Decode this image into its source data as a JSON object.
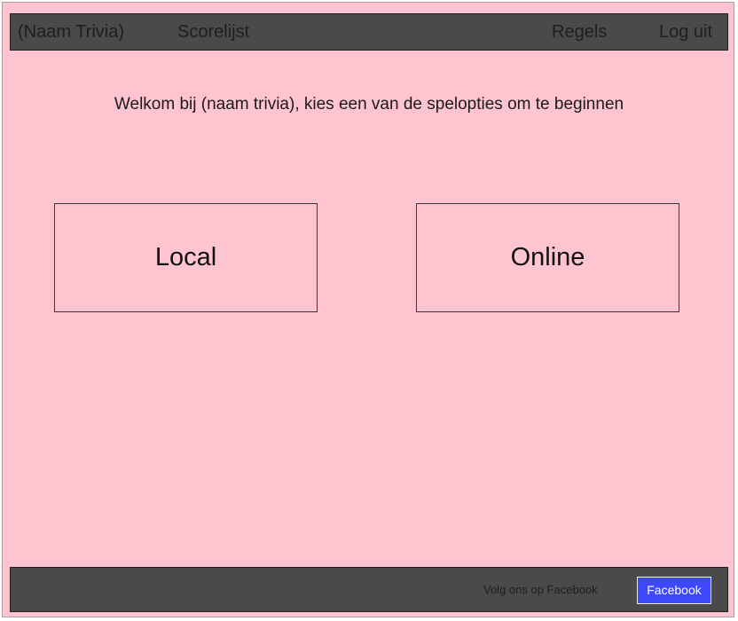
{
  "header": {
    "brand": "(Naam Trivia)",
    "nav": {
      "scoreboard": "Scorelijst",
      "rules": "Regels",
      "logout": "Log uit"
    }
  },
  "main": {
    "welcome_text": "Welkom bij (naam trivia), kies een van de spelopties om te beginnen",
    "modes": {
      "local": "Local",
      "online": "Online"
    }
  },
  "footer": {
    "follow_text": "Volg ons op Facebook",
    "facebook_button": "Facebook"
  },
  "colors": {
    "page_background": "#fec5d0",
    "bar_background": "#4a4a4a",
    "facebook_button": "#3f47fb"
  }
}
